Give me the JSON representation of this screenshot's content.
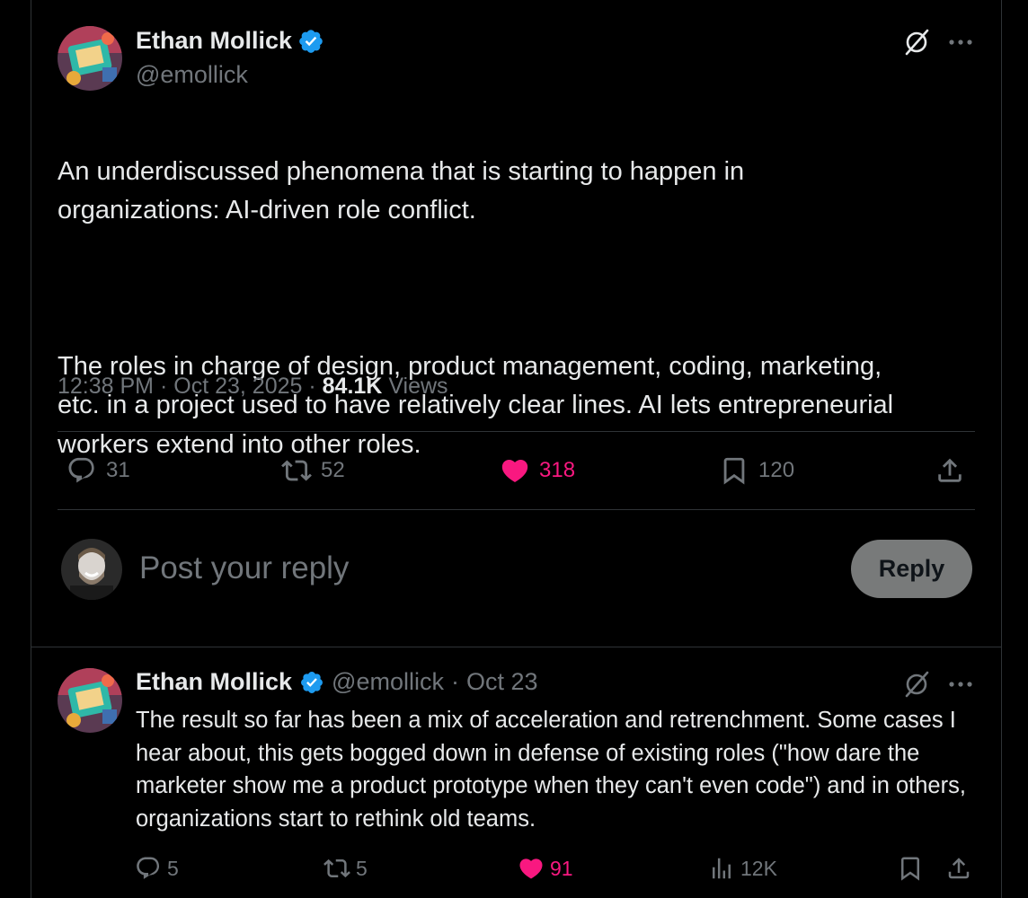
{
  "tweet": {
    "author_name": "Ethan Mollick",
    "author_handle": "@emollick",
    "paragraph_1": "An underdiscussed phenomena that is starting to happen in\norganizations: AI-driven role conflict.",
    "paragraph_2": "The roles in charge of design, product management, coding, marketing,\netc. in a project used to have relatively clear lines. AI lets entrepreneurial\nworkers extend into other roles.",
    "time": "12:38 PM",
    "date": "Oct 23, 2025",
    "views_count": "84.1K",
    "views_label": "Views",
    "replies": "31",
    "reposts": "52",
    "likes": "318",
    "bookmarks": "120"
  },
  "composer": {
    "placeholder": "Post your reply",
    "button_label": "Reply"
  },
  "reply_tweet": {
    "author_name": "Ethan Mollick",
    "author_handle": "@emollick",
    "separator": "·",
    "date": "Oct 23",
    "text": "The result so far has been a mix of acceleration and retrenchment. Some cases I hear about, this gets bogged down in defense of existing roles (\"how dare the marketer show me a product prototype when they can't even code\") and in others, organizations start to rethink old teams.",
    "replies": "5",
    "reposts": "5",
    "likes": "91",
    "views": "12K"
  },
  "colors": {
    "background": "#000000",
    "text_primary": "#e7e9ea",
    "text_secondary": "#71767b",
    "like_pink": "#f91880",
    "verified_blue": "#1d9bf0",
    "divider": "#2f3336"
  },
  "icons": [
    "verified-badge-icon",
    "grok-icon",
    "more-icon",
    "reply-icon",
    "repost-icon",
    "like-icon",
    "bookmark-icon",
    "share-icon",
    "views-icon"
  ]
}
